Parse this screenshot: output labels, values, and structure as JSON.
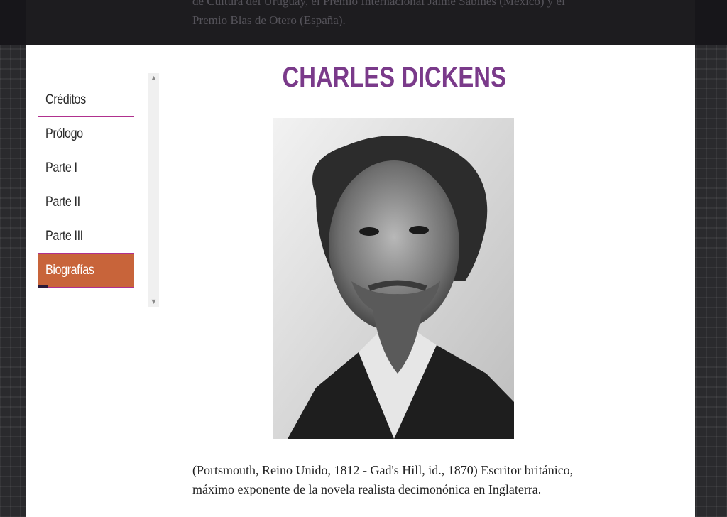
{
  "background_text": "de Cultura del Uruguay, el Premio Internacional Jaime Sabines (México) y el Premio Blas de Otero (España).",
  "sidebar": {
    "items": [
      {
        "label": "Créditos",
        "active": false
      },
      {
        "label": "Prólogo",
        "active": false
      },
      {
        "label": "Parte I",
        "active": false
      },
      {
        "label": "Parte II",
        "active": false
      },
      {
        "label": "Parte III",
        "active": false
      },
      {
        "label": "Biografías",
        "active": true
      }
    ]
  },
  "scrollbar": {
    "up_arrow": "▲",
    "down_arrow": "▼"
  },
  "main": {
    "title": "CHARLES DICKENS",
    "portrait_icon": "portrait-photo",
    "bio": "(Portsmouth, Reino Unido, 1812 - Gad's Hill, id., 1870) Escritor británico, máximo exponente de la novela realista decimonónica en Inglaterra."
  },
  "colors": {
    "accent": "#c8643a",
    "title": "#7a3a8a",
    "divider": "#b0308e"
  }
}
